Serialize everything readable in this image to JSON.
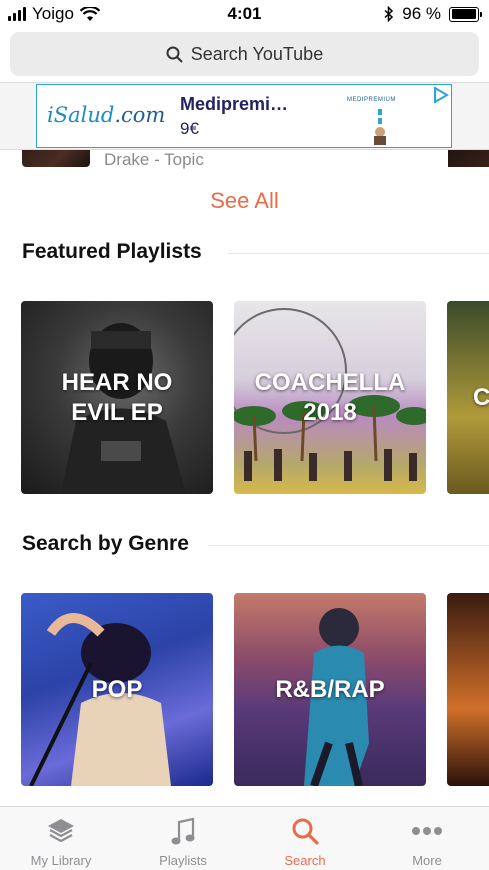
{
  "status_bar": {
    "carrier": "Yoigo",
    "time": "4:01",
    "battery": "96 %",
    "battery_level": 0.96
  },
  "search": {
    "placeholder": "Search YouTube"
  },
  "ad": {
    "logo_main": "iSalud",
    "logo_tld": ".com",
    "headline": "Medipremi…",
    "price": "9€",
    "brand": "MEDIPREMIUM"
  },
  "partial_result": {
    "subtitle": "Drake - Topic"
  },
  "see_all": "See All",
  "featured": {
    "title": "Featured Playlists",
    "items": [
      {
        "label": "HEAR NO EVIL EP"
      },
      {
        "label": "COACHELLA 2018"
      },
      {
        "label": "C"
      }
    ]
  },
  "genres": {
    "title": "Search by Genre",
    "items": [
      {
        "label": "POP"
      },
      {
        "label": "R&B/RAP"
      },
      {
        "label": ""
      }
    ]
  },
  "tabs": [
    {
      "label": "My Library",
      "icon": "layers-icon"
    },
    {
      "label": "Playlists",
      "icon": "music-note-icon"
    },
    {
      "label": "Search",
      "icon": "search-icon"
    },
    {
      "label": "More",
      "icon": "more-icon"
    }
  ],
  "colors": {
    "accent": "#e86c4a",
    "tab_inactive": "#8e8e93"
  }
}
